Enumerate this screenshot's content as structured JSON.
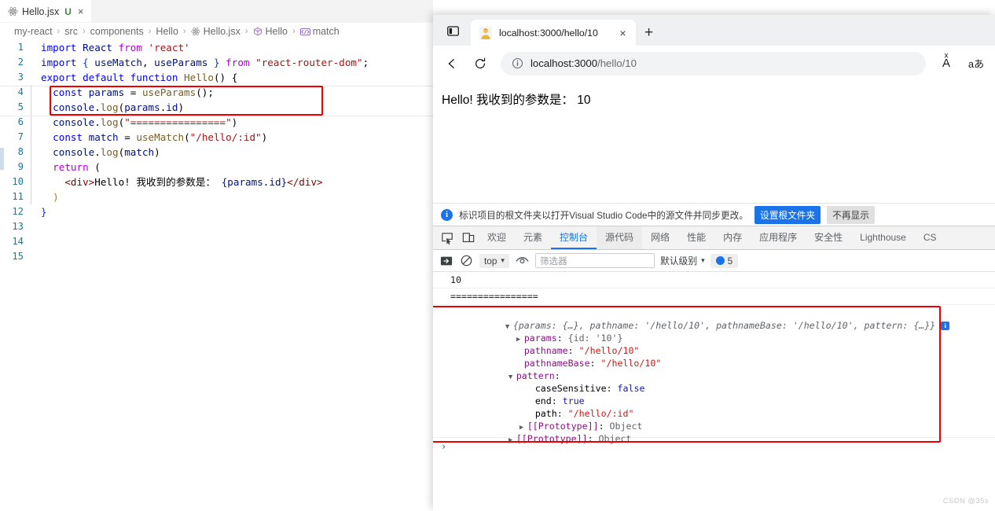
{
  "editor": {
    "tab": {
      "filename": "Hello.jsx",
      "status": "U",
      "close": "×",
      "icon": "react-icon"
    },
    "breadcrumb": [
      {
        "label": "my-react",
        "icon": null
      },
      {
        "label": "src",
        "icon": null
      },
      {
        "label": "components",
        "icon": null
      },
      {
        "label": "Hello",
        "icon": null
      },
      {
        "label": "Hello.jsx",
        "icon": "react-icon"
      },
      {
        "label": "Hello",
        "icon": "symbol-function-icon"
      },
      {
        "label": "match",
        "icon": "symbol-variable-icon"
      }
    ],
    "separator": "›",
    "lines": [
      {
        "n": "1",
        "text": "import React from 'react'"
      },
      {
        "n": "2",
        "text": "import { useMatch, useParams } from \"react-router-dom\";"
      },
      {
        "n": "3",
        "text": "export default function Hello() {"
      },
      {
        "n": "4",
        "text": "  const params = useParams();"
      },
      {
        "n": "5",
        "text": "  console.log(params.id)"
      },
      {
        "n": "6",
        "text": "  console.log(\"================\")"
      },
      {
        "n": "7",
        "text": "  const match = useMatch(\"/hello/:id\")"
      },
      {
        "n": "8",
        "text": "  console.log(match)"
      },
      {
        "n": "9",
        "text": "  return ("
      },
      {
        "n": "10",
        "text": "    <div>Hello! 我收到的参数是： {params.id}</div>"
      },
      {
        "n": "11",
        "text": "  )"
      },
      {
        "n": "12",
        "text": "}"
      },
      {
        "n": "13",
        "text": ""
      },
      {
        "n": "14",
        "text": ""
      },
      {
        "n": "15",
        "text": ""
      }
    ],
    "highlight_color": "#ee0000"
  },
  "browser": {
    "tab": {
      "title": "localhost:3000/hello/10",
      "close_label": "×",
      "favicon": "person-avatar-favicon"
    },
    "new_tab_label": "+",
    "tab_strip_button": "tab-actions-icon",
    "toolbar": {
      "back": "back-arrow-icon",
      "reload": "reload-icon",
      "site_info": "info-circle-icon",
      "url_host": "localhost:3000",
      "url_path": "/hello/10",
      "url_full": "localhost:3000/hello/10",
      "read_aloud": "Aͯ",
      "translate": "aあ"
    },
    "page": {
      "content": "Hello! 我收到的参数是：  10"
    },
    "infobar": {
      "icon": "info-icon",
      "message": "标识项目的根文件夹以打开Visual Studio Code中的源文件并同步更改。",
      "primary_button": "设置根文件夹",
      "secondary_button": "不再显示"
    }
  },
  "devtools": {
    "left_icons": [
      "inspect-element-icon",
      "device-toolbar-icon"
    ],
    "tabs": [
      {
        "label": "欢迎",
        "state": "normal"
      },
      {
        "label": "元素",
        "state": "normal"
      },
      {
        "label": "控制台",
        "state": "active"
      },
      {
        "label": "源代码",
        "state": "hover"
      },
      {
        "label": "网络",
        "state": "normal"
      },
      {
        "label": "性能",
        "state": "normal"
      },
      {
        "label": "内存",
        "state": "normal"
      },
      {
        "label": "应用程序",
        "state": "normal"
      },
      {
        "label": "安全性",
        "state": "normal"
      },
      {
        "label": "Lighthouse",
        "state": "normal"
      },
      {
        "label": "CS",
        "state": "normal"
      }
    ],
    "toolbar": {
      "clear_console": "clear-console-icon",
      "no_entry": "no-entry-icon",
      "context": "top",
      "context_caret": "▾",
      "eye": "live-expression-icon",
      "filter_placeholder": "筛选器",
      "filter_value": "",
      "level": "默认级别",
      "level_caret": "▾",
      "message_count": "5"
    },
    "console": {
      "messages": [
        {
          "kind": "plain",
          "text": "10"
        },
        {
          "kind": "plain",
          "text": "================"
        }
      ],
      "object": {
        "header_triangle": "▼",
        "header_text": "{params: {…}, pathname: '/hello/10', pathnameBase: '/hello/10', pattern: {…}}",
        "header_badge": "i",
        "rows": [
          {
            "indent": 1,
            "tri": "▶",
            "key": "params",
            "sep": ": ",
            "val": "{id: '10'}",
            "valType": "grey"
          },
          {
            "indent": 1,
            "tri": "",
            "key": "pathname",
            "sep": ": ",
            "val": "\"/hello/10\"",
            "valType": "str"
          },
          {
            "indent": 1,
            "tri": "",
            "key": "pathnameBase",
            "sep": ": ",
            "val": "\"/hello/10\"",
            "valType": "str"
          },
          {
            "indent": 1,
            "tri": "▼",
            "key": "pattern",
            "sep": ":",
            "val": "",
            "valType": "none"
          },
          {
            "indent": 2,
            "tri": "",
            "key": "caseSensitive",
            "sep": ": ",
            "val": "false",
            "valType": "bool"
          },
          {
            "indent": 2,
            "tri": "",
            "key": "end",
            "sep": ": ",
            "val": "true",
            "valType": "bool"
          },
          {
            "indent": 2,
            "tri": "",
            "key": "path",
            "sep": ": ",
            "val": "\"/hello/:id\"",
            "valType": "str"
          },
          {
            "indent": 2,
            "tri": "▶",
            "key": "[[Prototype]]",
            "sep": ": ",
            "val": "Object",
            "valType": "grey"
          },
          {
            "indent": 1,
            "tri": "▶",
            "key": "[[Prototype]]",
            "sep": ": ",
            "val": "Object",
            "valType": "grey"
          }
        ]
      },
      "prompt": "›"
    }
  },
  "watermark": "CSDN @35s"
}
